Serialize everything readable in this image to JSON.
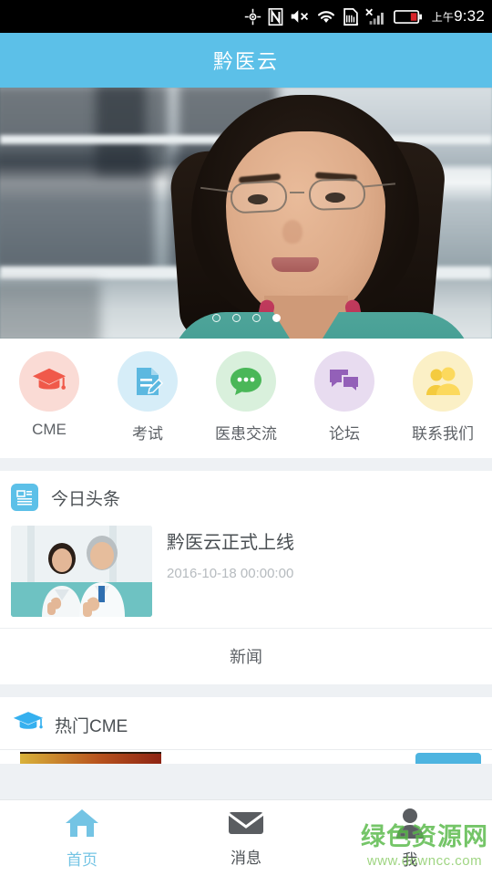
{
  "status_bar": {
    "icons": [
      "gps-icon",
      "nfc-icon",
      "mute-icon",
      "wifi-icon",
      "sdcard-alert-icon",
      "signal-no-service-icon",
      "battery-icon"
    ],
    "time": "9:32",
    "am_pm": "上午"
  },
  "app_bar": {
    "title": "黔医云"
  },
  "banner": {
    "alt": "女医生穿绿色手术服，背景为X光片阅片灯箱",
    "slide_count": 4,
    "active_slide": 4
  },
  "quick_nav": [
    {
      "label": "CME",
      "icon": "graduation-cap-icon",
      "bubble_color": "#fadbd5",
      "icon_color": "#f0594a"
    },
    {
      "label": "考试",
      "icon": "exam-paper-pen-icon",
      "bubble_color": "#d6edf8",
      "icon_color": "#5cb8e0"
    },
    {
      "label": "医患交流",
      "icon": "chat-bubble-dots-icon",
      "bubble_color": "#d9f0dc",
      "icon_color": "#4ab758"
    },
    {
      "label": "论坛",
      "icon": "forum-bubbles-icon",
      "bubble_color": "#e8dcf0",
      "icon_color": "#9360b8"
    },
    {
      "label": "联系我们",
      "icon": "contacts-people-icon",
      "bubble_color": "#fbf0c6",
      "icon_color": "#f4cb3f"
    }
  ],
  "headlines": {
    "section_title": "今日头条",
    "section_icon": "newspaper-icon",
    "item": {
      "thumb_alt": "两位白大褂医生竖大拇指",
      "title": "黔医云正式上线",
      "date": "2016-10-18 00:00:00"
    },
    "more_label": "新闻"
  },
  "hot_cme": {
    "section_title": "热门CME",
    "section_icon": "graduation-cap-icon"
  },
  "tab_bar": [
    {
      "label": "首页",
      "icon": "home-icon",
      "active": true
    },
    {
      "label": "消息",
      "icon": "envelope-icon",
      "active": false
    },
    {
      "label": "我",
      "icon": "person-icon",
      "active": false
    }
  ],
  "watermark": {
    "line1": "绿色资源网",
    "line2": "www.downcc.com"
  },
  "colors": {
    "brand": "#5cc0e8",
    "page_bg": "#eef1f4",
    "card_bg": "#ffffff",
    "text_primary": "#4c5155",
    "text_secondary": "#b6bbbf",
    "tab_active": "#74c4e4"
  }
}
